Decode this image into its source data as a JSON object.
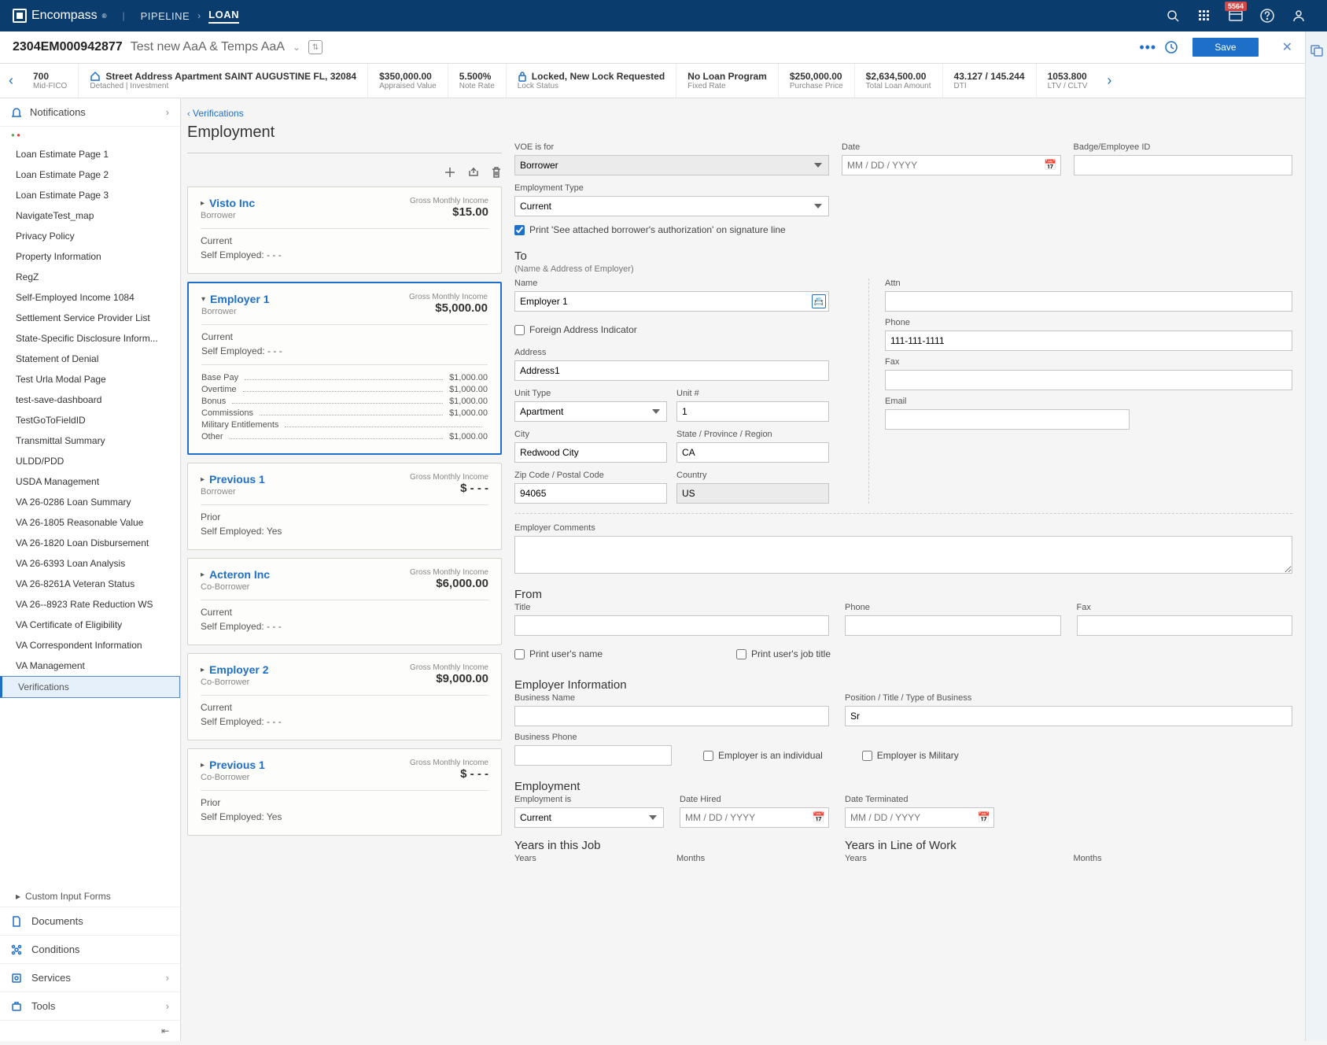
{
  "nav": {
    "brand": "Encompass",
    "pipeline": "PIPELINE",
    "loan": "LOAN",
    "badge": "5564"
  },
  "loanHeader": {
    "id": "2304EM000942877",
    "name": "Test new AaA & Temps AaA",
    "save": "Save"
  },
  "summary": [
    {
      "value": "700",
      "label": "Mid-FICO"
    },
    {
      "value": "Street Address Apartment SAINT AUGUSTINE FL, 32084",
      "label": "Detached | Investment",
      "icon": "home"
    },
    {
      "value": "$350,000.00",
      "label": "Appraised Value"
    },
    {
      "value": "5.500%",
      "label": "Note Rate"
    },
    {
      "value": "Locked, New Lock Requested",
      "label": "Lock Status",
      "icon": "lock"
    },
    {
      "value": "No Loan Program",
      "label": "Fixed Rate"
    },
    {
      "value": "$250,000.00",
      "label": "Purchase Price"
    },
    {
      "value": "$2,634,500.00",
      "label": "Total Loan Amount"
    },
    {
      "value": "43.127 / 145.244",
      "label": "DTI"
    },
    {
      "value": "1053.800",
      "label": "LTV / CLTV"
    }
  ],
  "sidebar": {
    "notifications": "Notifications",
    "items": [
      "Loan Estimate Page 1",
      "Loan Estimate Page 2",
      "Loan Estimate Page 3",
      "NavigateTest_map",
      "Privacy Policy",
      "Property Information",
      "RegZ",
      "Self-Employed Income 1084",
      "Settlement Service Provider List",
      "State-Specific Disclosure Inform...",
      "Statement of Denial",
      "Test Urla Modal Page",
      "test-save-dashboard",
      "TestGoToFieldID",
      "Transmittal Summary",
      "ULDD/PDD",
      "USDA Management",
      "VA 26-0286 Loan Summary",
      "VA 26-1805 Reasonable Value",
      "VA 26-1820 Loan Disbursement",
      "VA 26-6393 Loan Analysis",
      "VA 26-8261A Veteran Status",
      "VA 26--8923 Rate Reduction WS",
      "VA Certificate of Eligibility",
      "VA Correspondent Information",
      "VA Management",
      "Verifications"
    ],
    "customForms": "Custom Input Forms",
    "documents": "Documents",
    "conditions": "Conditions",
    "services": "Services",
    "tools": "Tools"
  },
  "page": {
    "breadcrumb": "Verifications",
    "title": "Employment"
  },
  "employers": [
    {
      "name": "Visto Inc",
      "party": "Borrower",
      "gmi": "$15.00",
      "status": "Current",
      "selfEmp": "Self Employed: - - -",
      "expanded": false
    },
    {
      "name": "Employer 1",
      "party": "Borrower",
      "gmi": "$5,000.00",
      "status": "Current",
      "selfEmp": "Self Employed: - - -",
      "expanded": true,
      "details": [
        {
          "label": "Base Pay",
          "value": "$1,000.00"
        },
        {
          "label": "Overtime",
          "value": "$1,000.00"
        },
        {
          "label": "Bonus",
          "value": "$1,000.00"
        },
        {
          "label": "Commissions",
          "value": "$1,000.00"
        },
        {
          "label": "Military Entitlements",
          "value": ""
        },
        {
          "label": "Other",
          "value": "$1,000.00"
        }
      ]
    },
    {
      "name": "Previous 1",
      "party": "Borrower",
      "gmi": "$ - - -",
      "status": "Prior",
      "selfEmp": "Self Employed: Yes",
      "expanded": false
    },
    {
      "name": "Acteron Inc",
      "party": "Co-Borrower",
      "gmi": "$6,000.00",
      "status": "Current",
      "selfEmp": "Self Employed: - - -",
      "expanded": false
    },
    {
      "name": "Employer 2",
      "party": "Co-Borrower",
      "gmi": "$9,000.00",
      "status": "Current",
      "selfEmp": "Self Employed: - - -",
      "expanded": false
    },
    {
      "name": "Previous 1",
      "party": "Co-Borrower",
      "gmi": "$ - - -",
      "status": "Prior",
      "selfEmp": "Self Employed: Yes",
      "expanded": false
    }
  ],
  "gmiLabel": "Gross Monthly Income",
  "form": {
    "voeLabel": "VOE is for",
    "voeValue": "Borrower",
    "dateLabel": "Date",
    "datePlaceholder": "MM / DD / YYYY",
    "badgeLabel": "Badge/Employee ID",
    "empTypeLabel": "Employment Type",
    "empTypeValue": "Current",
    "printAuth": "Print 'See attached borrower's authorization' on signature line",
    "toHeading": "To",
    "toSub": "(Name & Address of Employer)",
    "nameLabel": "Name",
    "nameValue": "Employer 1",
    "foreignAddr": "Foreign Address Indicator",
    "addressLabel": "Address",
    "addressValue": "Address1",
    "unitTypeLabel": "Unit Type",
    "unitTypeValue": "Apartment",
    "unitNumLabel": "Unit #",
    "unitNumValue": "1",
    "cityLabel": "City",
    "cityValue": "Redwood City",
    "stateLabel": "State / Province / Region",
    "stateValue": "CA",
    "zipLabel": "Zip Code / Postal Code",
    "zipValue": "94065",
    "countryLabel": "Country",
    "countryValue": "US",
    "attnLabel": "Attn",
    "phoneLabel": "Phone",
    "phoneValue": "111-111-1111",
    "faxLabel": "Fax",
    "emailLabel": "Email",
    "commentsLabel": "Employer Comments",
    "fromHeading": "From",
    "titleLabel": "Title",
    "printUserName": "Print user's name",
    "printUserJob": "Print user's job title",
    "empInfoHeading": "Employer Information",
    "bizNameLabel": "Business Name",
    "positionLabel": "Position / Title / Type of Business",
    "positionValue": "Sr",
    "bizPhoneLabel": "Business Phone",
    "empIndividual": "Employer is an individual",
    "empMilitary": "Employer is Military",
    "employmentHeading": "Employment",
    "empIsLabel": "Employment is",
    "empIsValue": "Current",
    "dateHiredLabel": "Date Hired",
    "dateTermLabel": "Date Terminated",
    "yearsJobHeading": "Years in this Job",
    "yearsLineHeading": "Years in Line of Work",
    "yearsLabel": "Years",
    "monthsLabel": "Months"
  }
}
